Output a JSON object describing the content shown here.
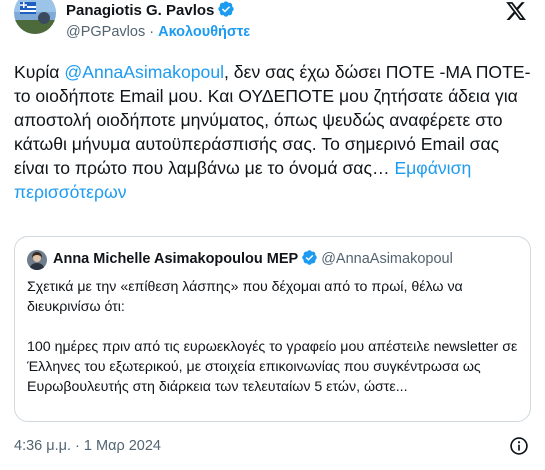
{
  "author": {
    "name": "Panagiotis G. Pavlos",
    "handle": "@PGPavlos",
    "separator": " · ",
    "follow_label": "Ακολουθήστε"
  },
  "tweet": {
    "text_before_mention": "Κυρία ",
    "mention": "@AnnaAsimakopoul",
    "text_after_mention": ", δεν σας έχω δώσει ΠΟΤΕ -ΜΑ ΠΟΤΕ- το οιοδήποτε Email μου. Και ΟΥΔΕΠΟΤΕ μου ζητήσατε άδεια για αποστολή οιοδήποτε μηνύματος, όπως ψευδώς αναφέρετε στο κάτωθι μήνυμα αυτοϋπεράσπισής σας. Το σημερινό Email σας είναι το πρώτο που λαμβάνω με το όνομά σας… ",
    "show_more": "Εμφάνιση περισσότερων"
  },
  "quote": {
    "name": "Anna Michelle Asimakopoulou MEP",
    "handle": "@AnnaAsimakopoul",
    "text": "Σχετικά με την «επίθεση λάσπης» που δέχομαι από το πρωί, θέλω να διευκρινίσω ότι:\n\n100 ημέρες πριν από τις ευρωεκλογές το γραφείο μου απέστειλε newsletter σε Έλληνες του εξωτερικού, με στοιχεία επικοινωνίας που συγκέντρωσα ως Ευρωβουλευτής στη διάρκεια των τελευταίων 5 ετών, ώστε..."
  },
  "footer": {
    "timestamp": "4:36 μ.μ. · 1 Μαρ 2024"
  },
  "colors": {
    "accent": "#1d9bf0",
    "text": "#0f1419",
    "muted": "#536471",
    "border": "#cfd9de"
  },
  "icons": {
    "verified": "verified-badge-icon",
    "x_logo": "x-logo-icon",
    "info": "info-icon"
  }
}
